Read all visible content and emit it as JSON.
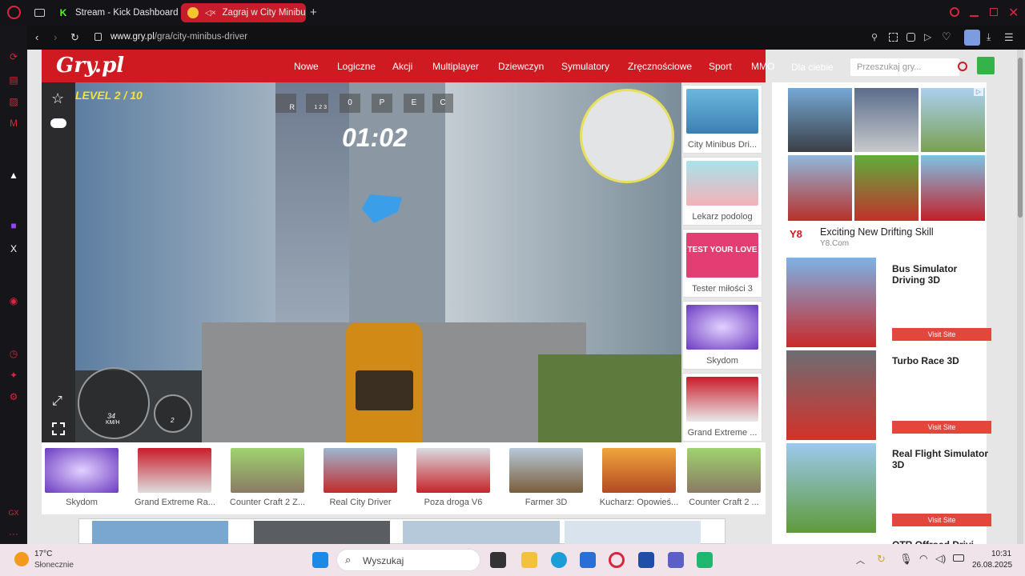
{
  "browser": {
    "tabs": [
      {
        "label": "Stream - Kick Dashboard"
      },
      {
        "label": "Zagraj w City Minibus"
      }
    ],
    "new_tab": "+",
    "url_host": "www.gry.pl",
    "url_path": "/gra/city-minibus-driver"
  },
  "site": {
    "logo": "Gry.pl",
    "nav": [
      "Nowe",
      "Logiczne",
      "Akcji",
      "Multiplayer",
      "Dziewczyn",
      "Symulatory",
      "Zręcznościowe",
      "Sport",
      "MMO",
      "Dla ciebie"
    ],
    "search_placeholder": "Przeszukaj gry..."
  },
  "game": {
    "level": "LEVEL 2 / 10",
    "timer": "01:02",
    "gears": [
      "R",
      "1 2 3",
      "0",
      "P",
      "E",
      "C"
    ],
    "speed": "34",
    "speed_unit": "KM/H",
    "rpm": "2"
  },
  "side_games": [
    "City Minibus Dri...",
    "Lekarz podolog",
    "Tester miłości 3",
    "Skydom",
    "Grand Extreme ..."
  ],
  "side_badge": "TEST YOUR LOVE",
  "bottom_games": [
    "Skydom",
    "Grand Extreme Ra...",
    "Counter Craft 2 Z...",
    "Real City Driver",
    "Poza droga V6",
    "Farmer 3D",
    "Kucharz: Opowieś...",
    "Counter Craft 2 ..."
  ],
  "ads": {
    "promo_title": "Exciting New Drifting Skill",
    "promo_source": "Y8.Com",
    "promo_logo": "Y8",
    "items": [
      {
        "title": "Bus Simulator Driving 3D",
        "button": "Visit Site"
      },
      {
        "title": "Turbo Race 3D",
        "button": "Visit Site"
      },
      {
        "title": "Real Flight Simulator 3D",
        "button": "Visit Site"
      }
    ],
    "partial_title": "OTR Offroad Drivi..."
  },
  "taskbar": {
    "temp": "17°C",
    "weather": "Słonecznie",
    "search": "Wyszukaj",
    "time": "10:31",
    "date": "26.08.2025"
  },
  "colors": {
    "brand": "#d01a22",
    "accent": "#c91c2b",
    "visit": "#e3473b"
  }
}
